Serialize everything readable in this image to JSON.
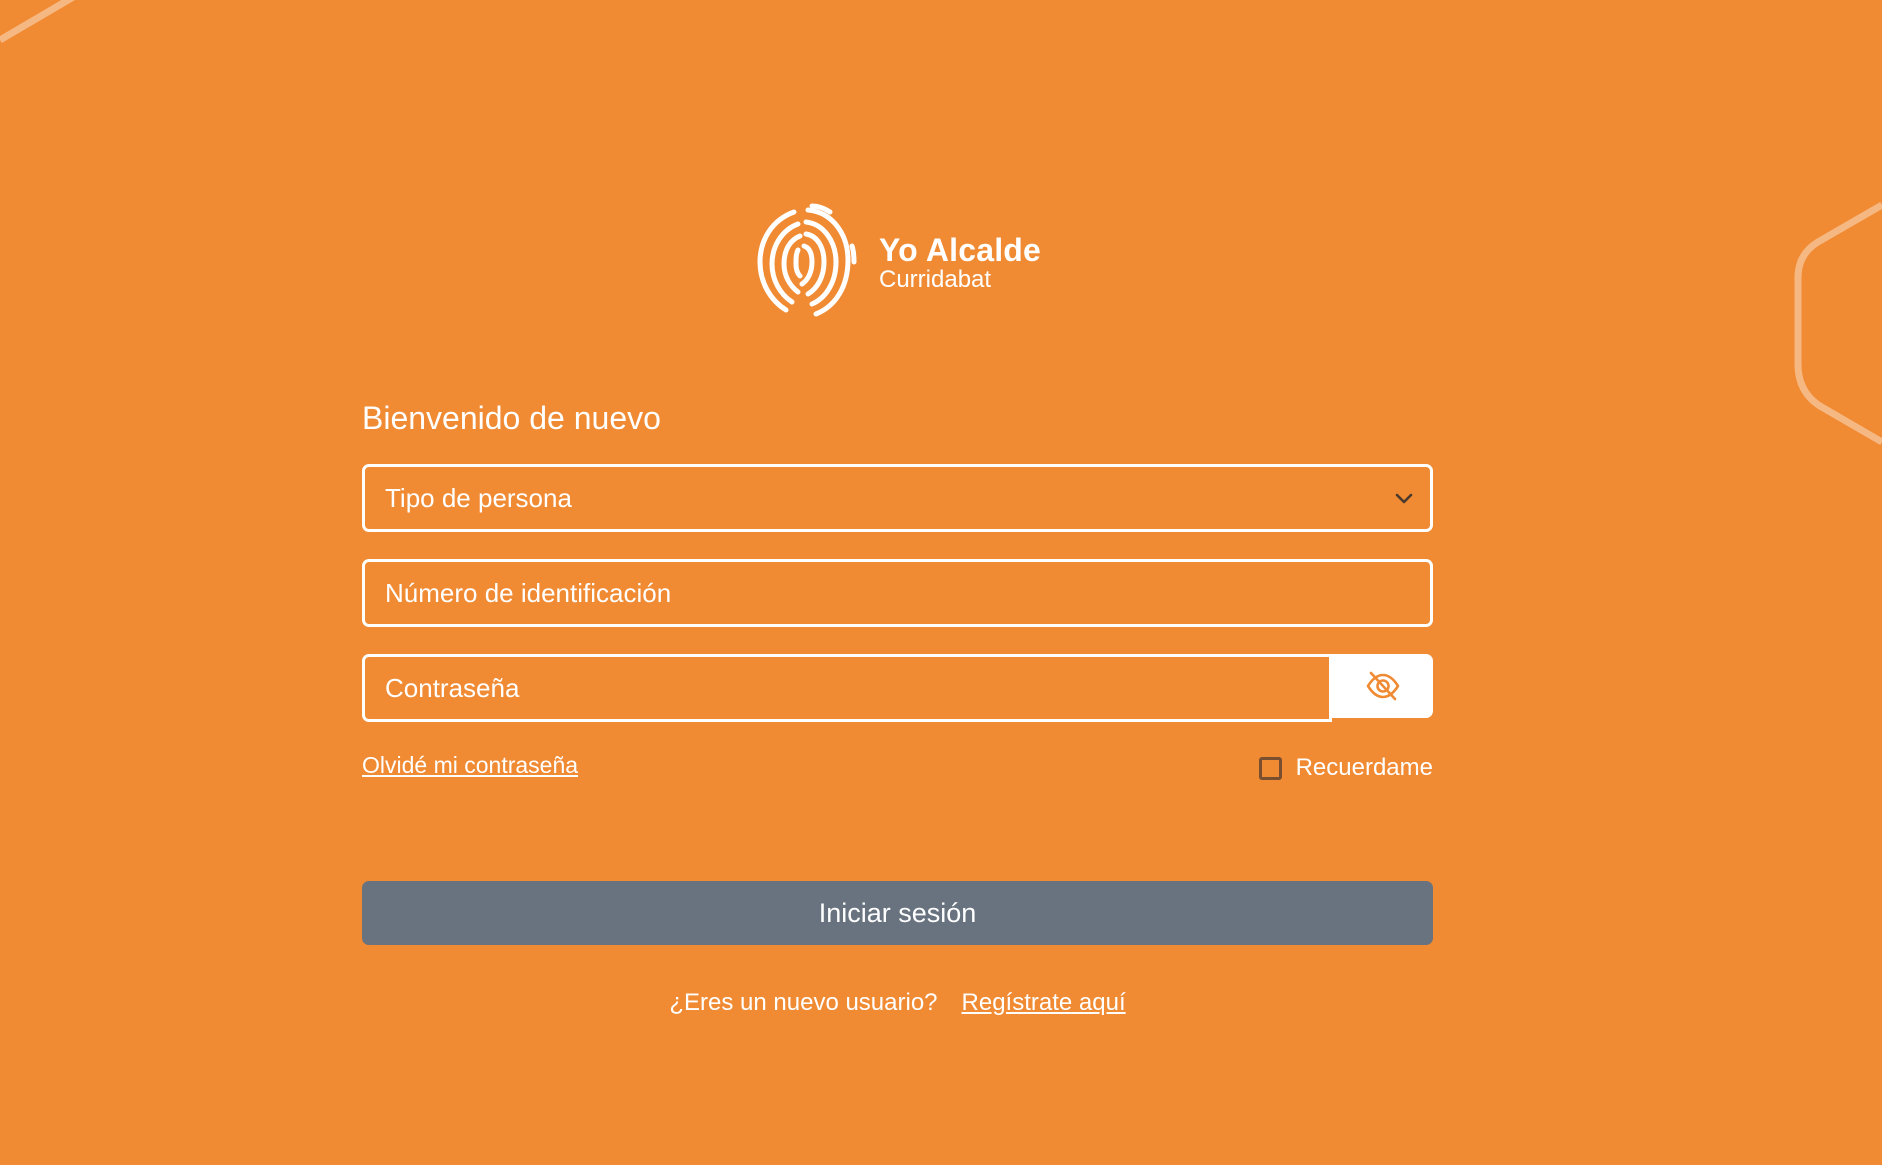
{
  "app": {
    "brand_title": "Yo Alcalde",
    "brand_subtitle": "Curridabat"
  },
  "colors": {
    "background": "#f08a33",
    "submit_button": "#68737f",
    "text": "#ffffff"
  },
  "form": {
    "welcome_heading": "Bienvenido de nuevo",
    "person_type_select": {
      "selected_value": "Tipo de persona"
    },
    "id_number_field": {
      "placeholder": "Número de identificación"
    },
    "password_field": {
      "placeholder": "Contraseña"
    },
    "forgot_password_link": "Olvidé mi contraseña",
    "remember_me_label": "Recuerdame",
    "remember_me_checked": false,
    "submit_label": "Iniciar sesión",
    "new_user_prompt": "¿Eres un nuevo usuario?",
    "register_link": "Regístrate aquí"
  },
  "icons": {
    "logo": "fingerprint-icon",
    "select_chevron": "chevron-down-icon",
    "password_toggle": "eye-slash-icon"
  }
}
